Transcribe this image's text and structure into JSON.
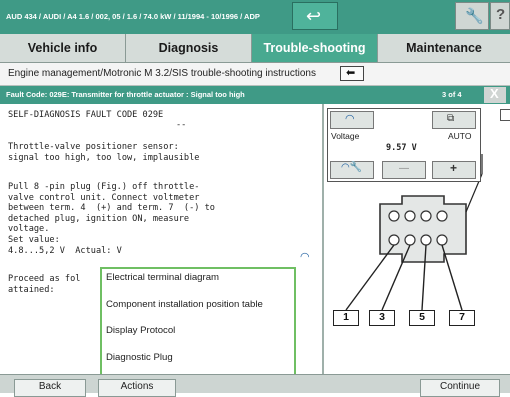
{
  "header": {
    "title": "AUD 434 / AUDI / A4 1.6 / 002, 05 / 1.6 / 74.0 kW / 11/1994 - 10/1996 / ADP",
    "back_icon": "back-arrow-icon",
    "tools_icon": "wrench-icon",
    "help_label": "?"
  },
  "tabs": [
    {
      "label": "Vehicle info",
      "active": false
    },
    {
      "label": "Diagnosis",
      "active": false
    },
    {
      "label": "Trouble-shooting",
      "active": true
    },
    {
      "label": "Maintenance",
      "active": false
    }
  ],
  "breadcrumb": {
    "text": "Engine management/Motronic M 3.2/SIS trouble-shooting instructions",
    "back_glyph": "⬅"
  },
  "fault_bar": {
    "text": "Fault Code: 029E: Transmitter for throttle actuator : Signal too high",
    "page": "3 of 4",
    "close_label": "X"
  },
  "instructions": {
    "line1": "SELF-DIAGNOSIS FAULT CODE 029E",
    "dashes": "--",
    "block2": "Throttle-valve positioner sensor:\nsignal too high, too low, implausible",
    "block3": "Pull 8 -pin plug (Fig.) off throttle-\nvalve control unit. Connect voltmeter\nbetween term. 4  (+) and term. 7  (-) to\ndetached plug, ignition ON, measure\nvoltage.\nSet value:\n4.8...5,2 V  Actual: V",
    "block4": "Proceed as fol\nattained:"
  },
  "popup_menu": {
    "items": [
      "Electrical terminal diagram",
      "Component installation position table",
      "Display Protocol",
      "Diagnostic Plug"
    ]
  },
  "meter": {
    "label": "Voltage",
    "mode": "AUTO",
    "value": "9.57 V",
    "minus_label": "—",
    "plus_label": "+"
  },
  "connector_legend": [
    "1",
    "3",
    "5",
    "7"
  ],
  "footer": {
    "back_label": "Back",
    "actions_label": "Actions",
    "continue_label": "Continue"
  },
  "colors": {
    "header_bg": "#3f9a86",
    "active_tab": "#48a990",
    "popup_border": "#6fbf63"
  }
}
